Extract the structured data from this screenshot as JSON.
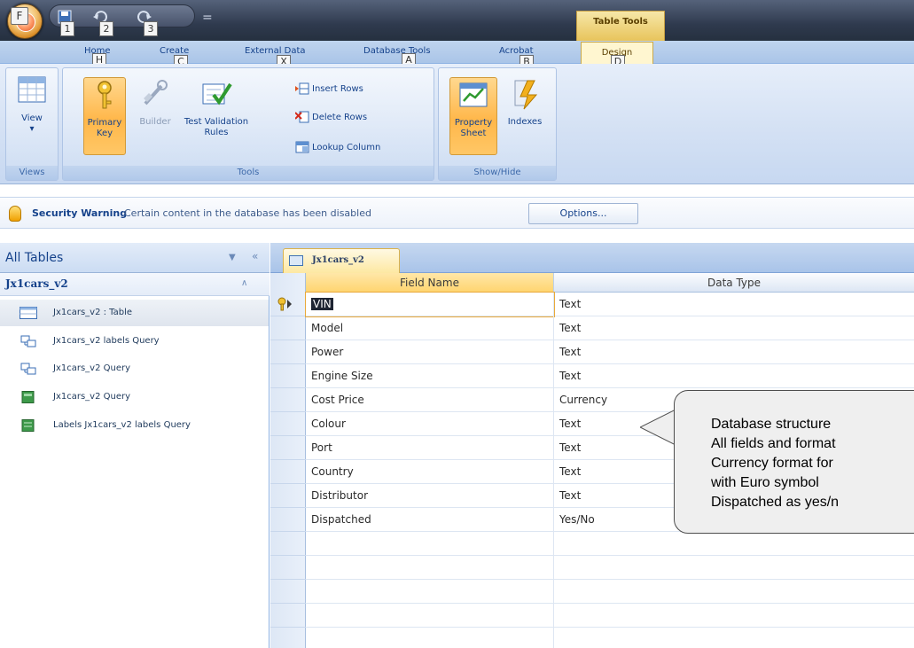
{
  "office_button": {
    "keytip": "F"
  },
  "quick_access": {
    "keytips": [
      "1",
      "2",
      "3"
    ]
  },
  "context": {
    "title": "Table Tools"
  },
  "ribbon_tabs": [
    {
      "label": "Home",
      "keytip": "H"
    },
    {
      "label": "Create",
      "keytip": "C"
    },
    {
      "label": "External Data",
      "keytip": "X"
    },
    {
      "label": "Database Tools",
      "keytip": "A"
    },
    {
      "label": "Acrobat",
      "keytip": "B"
    },
    {
      "label": "Design",
      "keytip": "D"
    }
  ],
  "ribbon": {
    "views": {
      "view_label": "View",
      "view_arrow": "▾",
      "group_label": "Views"
    },
    "tools": {
      "primary_key": "Primary Key",
      "builder": "Builder",
      "test_validation": "Test Validation Rules",
      "insert_rows": "Insert Rows",
      "delete_rows": "Delete Rows",
      "lookup_column": "Lookup Column",
      "group_label": "Tools"
    },
    "show_hide": {
      "property_sheet": "Property Sheet",
      "indexes": "Indexes",
      "group_label": "Show/Hide"
    }
  },
  "security_bar": {
    "title": "Security Warning",
    "message": "Certain content in the database has been disabled",
    "options_label": "Options..."
  },
  "nav": {
    "title": "All Tables",
    "group": "Jx1cars_v2",
    "items": [
      {
        "label": "Jx1cars_v2 : Table",
        "icon": "table-icon"
      },
      {
        "label": "Jx1cars_v2 labels Query",
        "icon": "query-icon"
      },
      {
        "label": "Jx1cars_v2 Query",
        "icon": "query-icon"
      },
      {
        "label": "Jx1cars_v2 Query",
        "icon": "form-icon"
      },
      {
        "label": "Labels Jx1cars_v2 labels Query",
        "icon": "report-icon"
      }
    ]
  },
  "document": {
    "tab_label": "Jx1cars_v2",
    "columns": {
      "field_name": "Field Name",
      "data_type": "Data Type"
    },
    "fields": [
      {
        "name": "VIN",
        "type": "Text"
      },
      {
        "name": "Model",
        "type": "Text"
      },
      {
        "name": "Power",
        "type": "Text"
      },
      {
        "name": "Engine Size",
        "type": "Text"
      },
      {
        "name": "Cost Price",
        "type": "Currency"
      },
      {
        "name": "Colour",
        "type": "Text"
      },
      {
        "name": "Port",
        "type": "Text"
      },
      {
        "name": "Country",
        "type": "Text"
      },
      {
        "name": "Distributor",
        "type": "Text"
      },
      {
        "name": "Dispatched",
        "type": "Yes/No"
      }
    ]
  },
  "callout": {
    "lines": [
      "Database structure",
      "All fields and format",
      "Currency format for",
      "with Euro symbol",
      "Dispatched as yes/n"
    ]
  },
  "colors": {
    "ribbon_accent": "#15428b",
    "active_orange": "#ffb74a",
    "context_gold": "#e8c45b"
  }
}
